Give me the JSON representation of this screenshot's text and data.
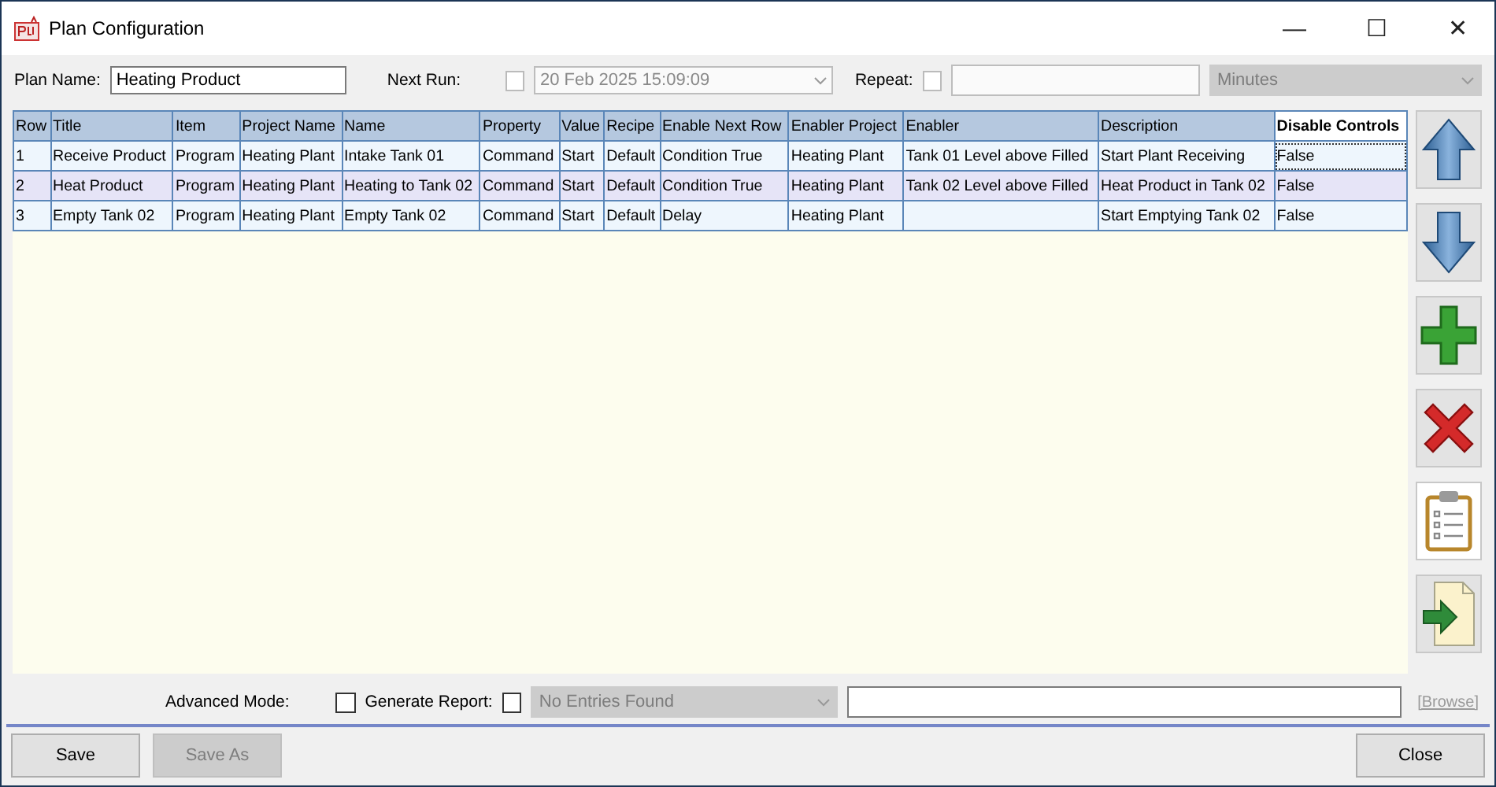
{
  "window": {
    "title": "Plan Configuration",
    "controls": [
      "—",
      "☐",
      "✕"
    ]
  },
  "toolbar": {
    "plan_name": {
      "label": "Plan Name:",
      "value": "Heating Product"
    },
    "next_run": {
      "label": "Next Run:",
      "checked": false,
      "value": "20 Feb 2025 15:09:09",
      "disabled": true
    },
    "repeat": {
      "label": "Repeat:",
      "checked": false,
      "disabled": true,
      "unit": "Minutes"
    }
  },
  "table": {
    "columns": [
      "Row",
      "Title",
      "Item",
      "Project Name",
      "Name",
      "Property",
      "Value",
      "Recipe",
      "Enable Next Row",
      "Enabler Project",
      "Enabler",
      "Description",
      "Disable Controls"
    ],
    "rows": [
      {
        "selected": false,
        "focused": true,
        "cells": [
          "1",
          "Receive Product",
          "Program",
          "Heating Plant",
          "Intake Tank 01",
          "Command",
          "Start",
          "Default",
          "Condition True",
          "Heating Plant",
          "Tank 01 Level above Filled",
          "Start Plant Receiving",
          "False"
        ]
      },
      {
        "selected": true,
        "focused": false,
        "cells": [
          "2",
          "Heat Product",
          "Program",
          "Heating Plant",
          "Heating to Tank 02",
          "Command",
          "Start",
          "Default",
          "Condition True",
          "Heating Plant",
          "Tank 02 Level above Filled",
          "Heat Product in Tank 02",
          "False"
        ]
      },
      {
        "selected": false,
        "focused": false,
        "cells": [
          "3",
          "Empty Tank 02",
          "Program",
          "Heating Plant",
          "Empty Tank 02",
          "Command",
          "Start",
          "Default",
          "Delay",
          "Heating Plant",
          "",
          "Start Emptying Tank 02",
          "False"
        ]
      }
    ]
  },
  "side_buttons": [
    {
      "kind": "up"
    },
    {
      "kind": "down"
    },
    {
      "kind": "add"
    },
    {
      "kind": "delete"
    },
    {
      "kind": "clipboard"
    },
    {
      "kind": "export"
    }
  ],
  "options": {
    "advanced_mode": {
      "label": "Advanced Mode:",
      "checked": false
    },
    "generate_report": {
      "label": "Generate Report:",
      "checked": false
    },
    "report": {
      "value": "No Entries Found",
      "disabled": true
    },
    "browse": {
      "label": "[Browse]",
      "disabled": true
    }
  },
  "buttons": [
    {
      "label": "Save",
      "disabled": false
    },
    {
      "label": "Save As",
      "disabled": true
    },
    {
      "label": "Close",
      "disabled": false
    }
  ]
}
